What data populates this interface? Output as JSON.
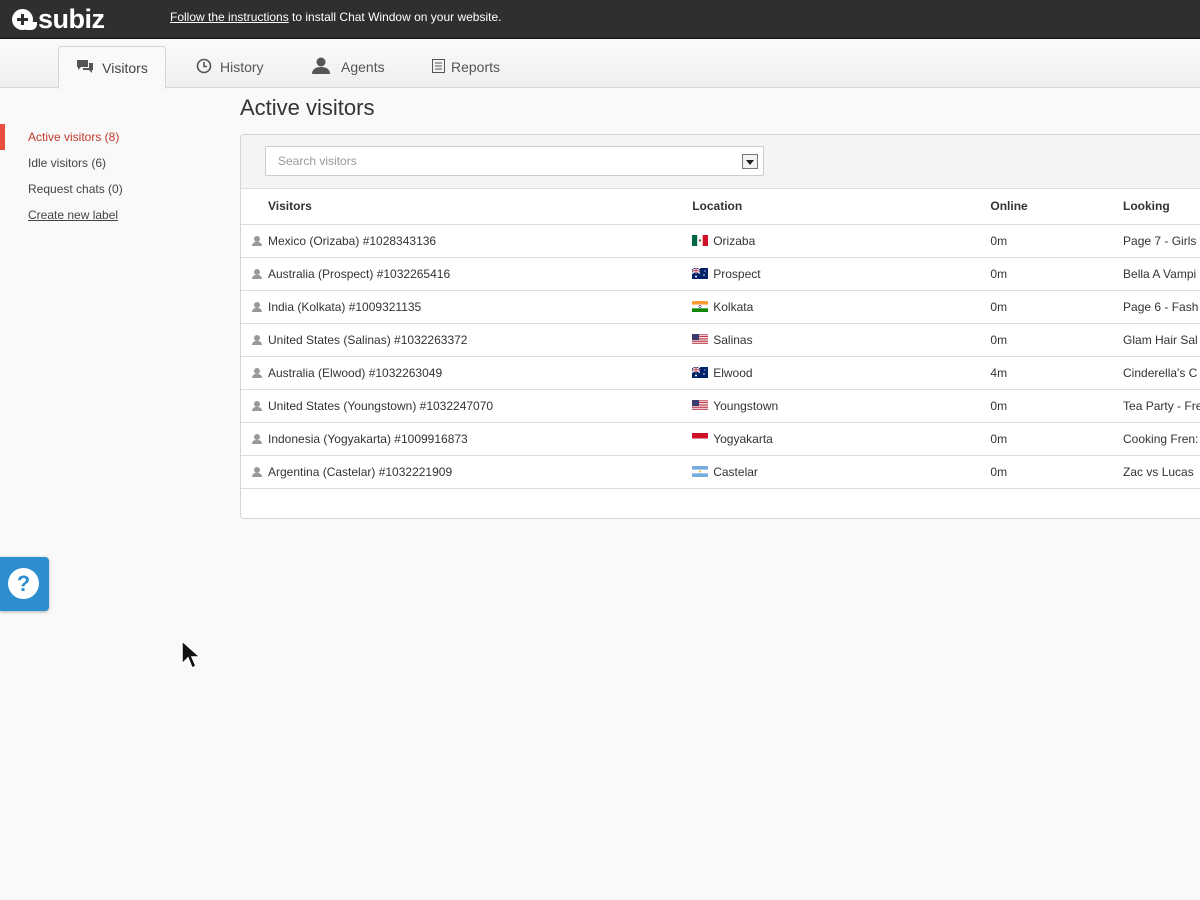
{
  "topbar": {
    "logo_text": "subiz",
    "install_link": "Follow the instructions",
    "install_rest": " to install Chat Window on your website."
  },
  "tabs": [
    {
      "label": "Visitors",
      "icon": "chat-bubbles-icon",
      "active": true
    },
    {
      "label": "History",
      "icon": "clock-icon"
    },
    {
      "label": "Agents",
      "icon": "person-icon"
    },
    {
      "label": "Reports",
      "icon": "report-icon"
    }
  ],
  "sidebar": {
    "items": [
      {
        "label": "Active visitors (8)",
        "active": true
      },
      {
        "label": "Idle visitors (6)"
      },
      {
        "label": "Request chats (0)"
      },
      {
        "label": "Create new label",
        "link": true
      }
    ]
  },
  "main": {
    "title": "Active visitors",
    "search_placeholder": "Search visitors",
    "columns": [
      "Visitors",
      "Location",
      "Online",
      "Looking"
    ],
    "rows": [
      {
        "visitor": "Mexico (Orizaba) #1028343136",
        "location": "Orizaba",
        "flag": "mx",
        "online": "0m",
        "looking": "Page 7 - Girls"
      },
      {
        "visitor": "Australia (Prospect) #1032265416",
        "location": "Prospect",
        "flag": "au",
        "online": "0m",
        "looking": "Bella A Vampi"
      },
      {
        "visitor": "India (Kolkata) #1009321135",
        "location": "Kolkata",
        "flag": "in",
        "online": "0m",
        "looking": "Page 6 - Fash"
      },
      {
        "visitor": "United States (Salinas) #1032263372",
        "location": "Salinas",
        "flag": "us",
        "online": "0m",
        "looking": "Glam Hair Sal"
      },
      {
        "visitor": "Australia (Elwood) #1032263049",
        "location": "Elwood",
        "flag": "au",
        "online": "4m",
        "looking": "Cinderella's C"
      },
      {
        "visitor": "United States (Youngstown) #1032247070",
        "location": "Youngstown",
        "flag": "us",
        "online": "0m",
        "looking": "Tea Party - Fre"
      },
      {
        "visitor": "Indonesia (Yogyakarta) #1009916873",
        "location": "Yogyakarta",
        "flag": "id",
        "online": "0m",
        "looking": "Cooking Fren:"
      },
      {
        "visitor": "Argentina (Castelar) #1032221909",
        "location": "Castelar",
        "flag": "ar",
        "online": "0m",
        "looking": "Zac vs Lucas"
      }
    ]
  },
  "help": {
    "label": "?"
  },
  "colors": {
    "accent": "#e74c3c",
    "help_blue": "#2d8fd0",
    "topbar": "#2f2f2f"
  }
}
